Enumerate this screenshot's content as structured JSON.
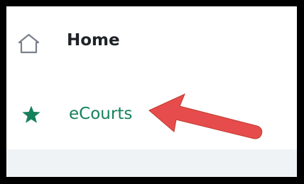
{
  "nav": {
    "items": [
      {
        "label": "Home",
        "icon": "home-icon"
      },
      {
        "label": "eCourts",
        "icon": "star-icon"
      }
    ]
  },
  "annotation": {
    "type": "arrow",
    "points_to": "eCourts"
  },
  "colors": {
    "accent": "#15805e",
    "home_icon_stroke": "#7a7f8a",
    "annotation_arrow": "#e74c4c",
    "frame_border": "#000000",
    "bottom_strip": "#f0f3f6"
  }
}
